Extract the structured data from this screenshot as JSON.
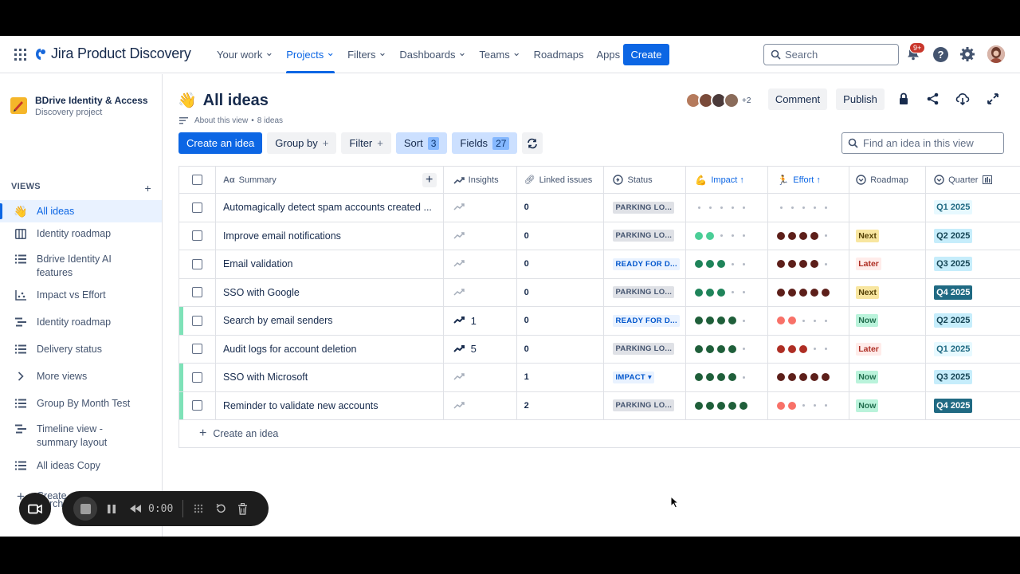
{
  "app": {
    "title": "Jira Product Discovery"
  },
  "nav": {
    "items": [
      {
        "label": "Your work",
        "dropdown": true,
        "active": false
      },
      {
        "label": "Projects",
        "dropdown": true,
        "active": true
      },
      {
        "label": "Filters",
        "dropdown": true,
        "active": false
      },
      {
        "label": "Dashboards",
        "dropdown": true,
        "active": false
      },
      {
        "label": "Teams",
        "dropdown": true,
        "active": false
      },
      {
        "label": "Roadmaps",
        "dropdown": false,
        "active": false
      },
      {
        "label": "Apps",
        "dropdown": true,
        "active": false
      }
    ],
    "create_label": "Create",
    "search_placeholder": "Search",
    "notifications_badge": "9+",
    "help_label": "?"
  },
  "sidebar": {
    "project_name": "BDrive Identity & Access",
    "project_type": "Discovery project",
    "views_heading": "VIEWS",
    "views_add": "+",
    "items": [
      {
        "label": "All ideas",
        "icon": "waving-hand-icon",
        "selected": true
      },
      {
        "label": "Identity roadmap",
        "icon": "board-icon"
      },
      {
        "label": "Bdrive Identity AI features",
        "icon": "list-icon"
      },
      {
        "label": "Impact vs Effort",
        "icon": "matrix-icon"
      },
      {
        "label": "Identity roadmap",
        "icon": "timeline-icon"
      },
      {
        "label": "Delivery status",
        "icon": "list-icon"
      },
      {
        "label": "More views",
        "icon": "chevron-right-icon"
      },
      {
        "label": "Group By Month Test",
        "icon": "list-icon"
      },
      {
        "label": "Timeline view - summary layout",
        "icon": "timeline-icon"
      },
      {
        "label": "All ideas Copy",
        "icon": "list-icon"
      },
      {
        "label": "Create a view",
        "icon": "plus-icon"
      }
    ],
    "archive_partial": "rchiv"
  },
  "view": {
    "title": "All ideas",
    "about": "About this view",
    "separator": "•",
    "idea_count": "8 ideas",
    "avatars_more": "+2",
    "comment_label": "Comment",
    "publish_label": "Publish",
    "toolbar": {
      "create_idea": "Create an idea",
      "group_by": "Group by",
      "filter": "Filter",
      "sort": "Sort",
      "sort_count": "3",
      "fields": "Fields",
      "fields_count": "27",
      "plus": "+"
    },
    "find_placeholder": "Find an idea in this view"
  },
  "table": {
    "columns": {
      "summary": "Summary",
      "insights": "Insights",
      "linked": "Linked issues",
      "status": "Status",
      "impact": "Impact",
      "effort": "Effort",
      "roadmap": "Roadmap",
      "quarter": "Quarter"
    },
    "rows": [
      {
        "summary": "Automagically detect spam accounts created ...",
        "insights": "",
        "insights_active": false,
        "linked": "0",
        "status": "PARKING LO...",
        "status_style": "gray",
        "impact": 0,
        "effort": 0,
        "roadmap": "",
        "quarter": "Q1 2025",
        "quarter_style": "light",
        "highlight": false
      },
      {
        "summary": "Improve email notifications",
        "insights": "",
        "insights_active": false,
        "linked": "0",
        "status": "PARKING LO...",
        "status_style": "gray",
        "impact": 2,
        "effort": 4,
        "roadmap": "Next",
        "quarter": "Q2 2025",
        "quarter_style": "med",
        "highlight": false
      },
      {
        "summary": "Email validation",
        "insights": "",
        "insights_active": false,
        "linked": "0",
        "status": "READY FOR D...",
        "status_style": "blue",
        "impact": 3,
        "effort": 4,
        "roadmap": "Later",
        "quarter": "Q3 2025",
        "quarter_style": "med",
        "highlight": false
      },
      {
        "summary": "SSO with Google",
        "insights": "",
        "insights_active": false,
        "linked": "0",
        "status": "PARKING LO...",
        "status_style": "gray",
        "impact": 3,
        "effort": 5,
        "roadmap": "Next",
        "quarter": "Q4 2025",
        "quarter_style": "dark",
        "highlight": false
      },
      {
        "summary": "Search by email senders",
        "insights": "1",
        "insights_active": true,
        "linked": "0",
        "status": "READY FOR D...",
        "status_style": "blue",
        "impact": 4,
        "effort": 2,
        "roadmap": "Now",
        "quarter": "Q2 2025",
        "quarter_style": "med",
        "highlight": true
      },
      {
        "summary": "Audit logs for account deletion",
        "insights": "5",
        "insights_active": true,
        "linked": "0",
        "status": "PARKING LO...",
        "status_style": "gray",
        "impact": 4,
        "effort": 3,
        "roadmap": "Later",
        "quarter": "Q1 2025",
        "quarter_style": "light",
        "highlight": false
      },
      {
        "summary": "SSO with Microsoft",
        "insights": "",
        "insights_active": false,
        "linked": "1",
        "status": "IMPACT",
        "status_style": "blue",
        "status_dropdown": true,
        "impact": 4,
        "effort": 5,
        "roadmap": "Now",
        "quarter": "Q3 2025",
        "quarter_style": "med",
        "highlight": true
      },
      {
        "summary": "Reminder to validate new accounts",
        "insights": "",
        "insights_active": false,
        "linked": "2",
        "status": "PARKING LO...",
        "status_style": "gray",
        "impact": 5,
        "effort": 2,
        "roadmap": "Now",
        "quarter": "Q4 2025",
        "quarter_style": "dark",
        "highlight": true
      }
    ],
    "add_row_label": "Create an idea"
  },
  "recorder": {
    "time": "0:00"
  },
  "colors": {
    "accent": "#0c66e4",
    "impact_dot": "#1f845a",
    "impact_light": "#4bce97",
    "effort_dark": "#5d1f1a",
    "effort_light": "#f87168"
  }
}
